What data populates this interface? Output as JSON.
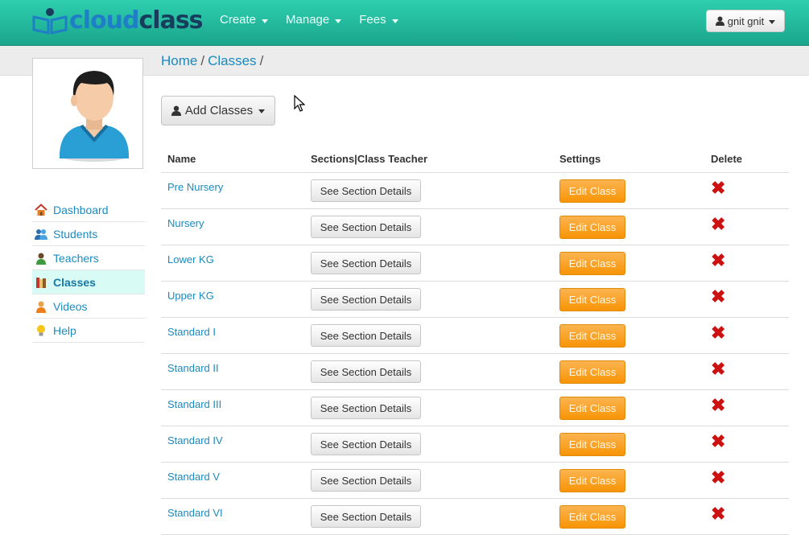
{
  "brand": {
    "part1": "cloud",
    "part2": "class"
  },
  "nav": {
    "items": [
      {
        "label": "Create"
      },
      {
        "label": "Manage"
      },
      {
        "label": "Fees"
      }
    ],
    "user_label": "gnit gnit"
  },
  "breadcrumb": {
    "home": "Home",
    "sep1": "/",
    "current": "Classes",
    "sep2": "/"
  },
  "sidebar": {
    "items": [
      {
        "label": "Dashboard",
        "icon": "home-icon"
      },
      {
        "label": "Students",
        "icon": "students-icon"
      },
      {
        "label": "Teachers",
        "icon": "teacher-icon"
      },
      {
        "label": "Classes",
        "icon": "books-icon",
        "active": true
      },
      {
        "label": "Videos",
        "icon": "video-user-icon"
      },
      {
        "label": "Help",
        "icon": "lightbulb-icon"
      }
    ]
  },
  "main": {
    "add_button": "Add Classes",
    "table": {
      "headers": [
        "Name",
        "Sections|Class Teacher",
        "Settings",
        "Delete"
      ],
      "section_button": "See Section Details",
      "edit_button": "Edit Class",
      "delete_icon": "delete-x-icon",
      "rows": [
        {
          "name": "Pre Nursery"
        },
        {
          "name": "Nursery"
        },
        {
          "name": "Lower KG"
        },
        {
          "name": "Upper KG"
        },
        {
          "name": "Standard I"
        },
        {
          "name": "Standard II"
        },
        {
          "name": "Standard III"
        },
        {
          "name": "Standard IV"
        },
        {
          "name": "Standard V"
        },
        {
          "name": "Standard VI"
        }
      ]
    }
  },
  "colors": {
    "navbar": "#1fb99c",
    "link": "#1a8ac0",
    "edit_button": "#f89406",
    "delete": "#cc1111",
    "active_sidebar": "#d8fbf6"
  }
}
